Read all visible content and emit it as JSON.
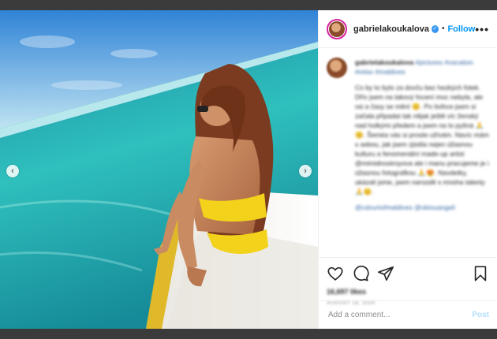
{
  "post": {
    "username": "gabrielakoukalova",
    "verified_badge": "✓",
    "separator": "•",
    "follow_label": "Follow",
    "more_label": "•••",
    "caption": {
      "username": "gabrielakoukalova",
      "tags_line": "#pictures #vacation #relax #maldives",
      "paragraph": "Co by to bylo za dovču bez hezkých fotek. Dřív jsem na takový focení moc nebyla, ale vsi a časy se mění 😊. Po tivihce jsem si začala připadat tak nějak ještě víc ženský nad holkými předem a jsem na to pyšná 🙏😊. Šeméa vás si proste užívám. Navíc mám s sebou, jak jsem zjistila nejen úžasnou kulturu a fenomenální made-up artist @mimidnostroyova ale i manu pracujeme je i úžasnou fotografkou 🙏😍. Navdetky, ukázali jsme, jsem narozdě s mnoha talenty 🙏😊.",
      "mentions": "@cdourtofmaldives @okiouangeli"
    },
    "likes": "16,697 likes",
    "date": "AUGUST 18, 2020",
    "add_comment_placeholder": "Add a comment...",
    "post_label": "Post",
    "icons": {
      "like": "heart-icon",
      "comment": "comment-icon",
      "share": "share-icon",
      "save": "bookmark-icon",
      "prev": "chevron-left-icon",
      "next": "chevron-right-icon"
    },
    "nav_prev": "‹",
    "nav_next": "›"
  },
  "colors": {
    "accent": "#0095f6",
    "backdrop": "#3b3b3b",
    "ring": "#d6249f"
  }
}
